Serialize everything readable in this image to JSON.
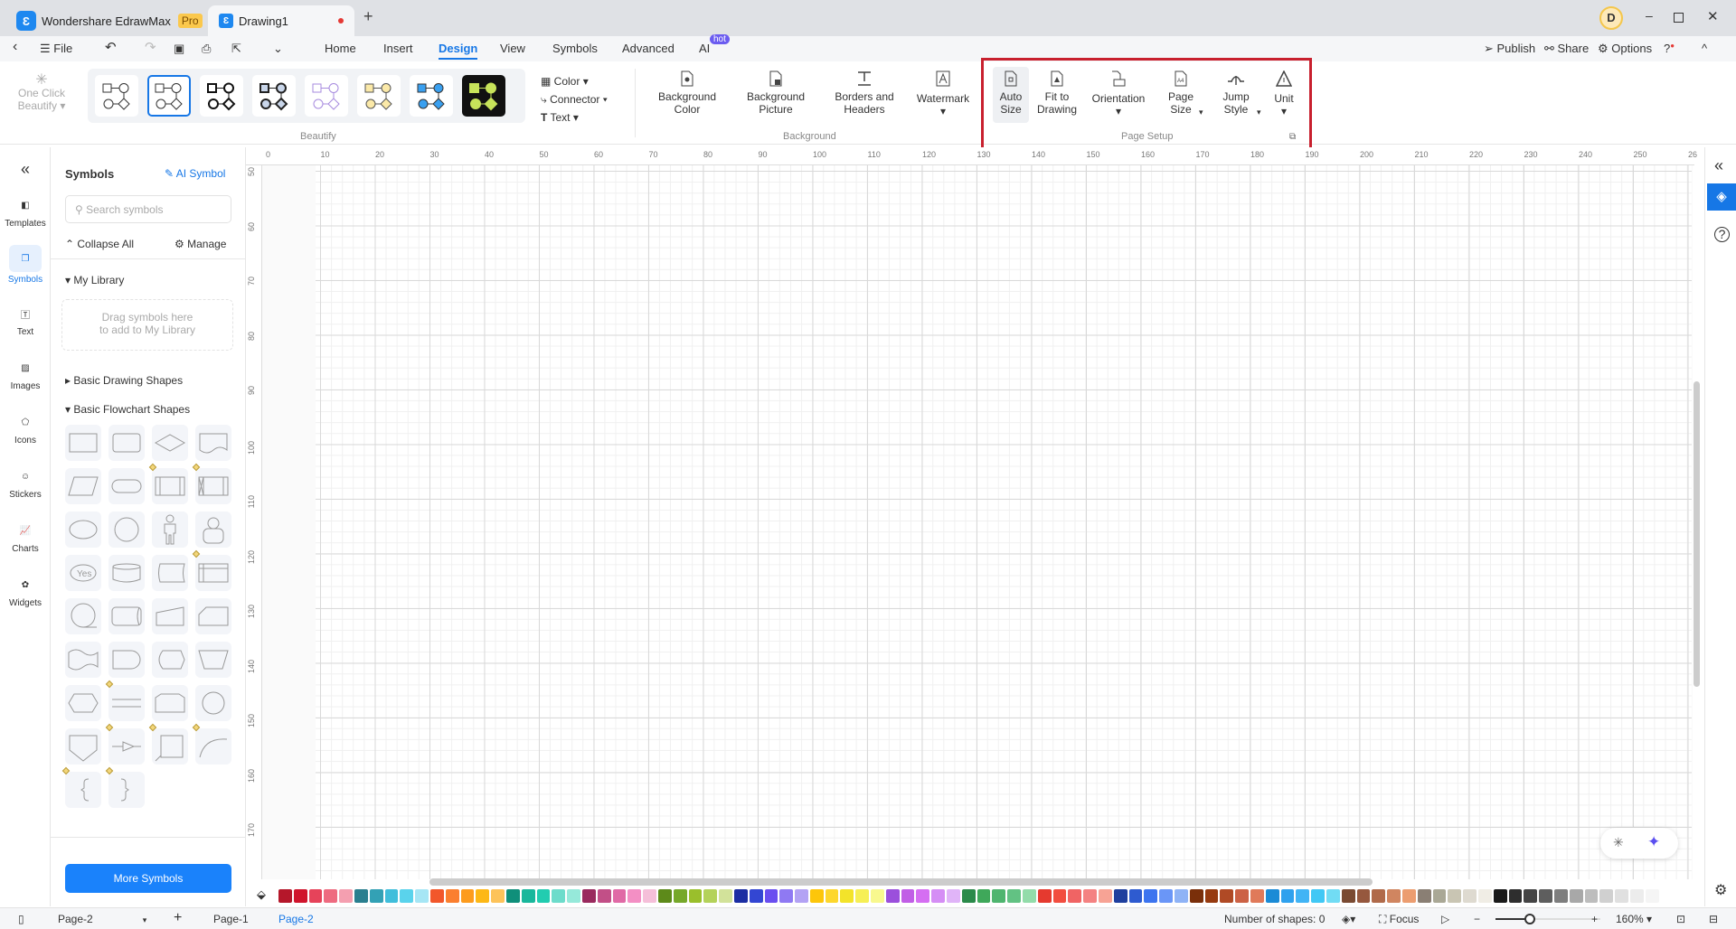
{
  "titlebar": {
    "app_name": "Wondershare EdrawMax",
    "badge": "Pro",
    "doc_tab": "Drawing1",
    "new_tab": "+",
    "avatar": "D"
  },
  "menubar": {
    "file": "File",
    "tabs": [
      "Home",
      "Insert",
      "Design",
      "View",
      "Symbols",
      "Advanced",
      "AI"
    ],
    "active_tab": "Design",
    "ai_badge": "hot",
    "publish": "Publish",
    "share": "Share",
    "options": "Options"
  },
  "ribbon": {
    "beautify": {
      "one_click": "One Click",
      "beautify_word": "Beautify",
      "group_label": "Beautify",
      "selected_index": 1
    },
    "format": {
      "color": "Color",
      "connector": "Connector",
      "text": "Text"
    },
    "background": {
      "group_label": "Background",
      "items": [
        {
          "l1": "Background",
          "l2": "Color"
        },
        {
          "l1": "Background",
          "l2": "Picture"
        },
        {
          "l1": "Borders and",
          "l2": "Headers"
        },
        {
          "l1": "Watermark",
          "l2": ""
        }
      ]
    },
    "page_setup": {
      "group_label": "Page Setup",
      "items": [
        {
          "l1": "Auto",
          "l2": "Size"
        },
        {
          "l1": "Fit to",
          "l2": "Drawing"
        },
        {
          "l1": "Orientation",
          "l2": ""
        },
        {
          "l1": "Page",
          "l2": "Size"
        },
        {
          "l1": "Jump",
          "l2": "Style"
        },
        {
          "l1": "Unit",
          "l2": ""
        }
      ],
      "highlight_color": "#c8202e"
    }
  },
  "leftnav": [
    "Templates",
    "Symbols",
    "Text",
    "Images",
    "Icons",
    "Stickers",
    "Charts",
    "Widgets"
  ],
  "panel": {
    "title": "Symbols",
    "ai_symbol": "AI Symbol",
    "search_placeholder": "Search symbols",
    "collapse_all": "Collapse All",
    "manage": "Manage",
    "my_library": "My Library",
    "drop_hint_1": "Drag symbols here",
    "drop_hint_2": "to add to My Library",
    "basic_drawing": "Basic Drawing Shapes",
    "basic_flowchart": "Basic Flowchart Shapes",
    "shape_text_yes": "Yes",
    "more_symbols": "More Symbols"
  },
  "ruler": {
    "top": [
      "0",
      "10",
      "20",
      "30",
      "40",
      "50",
      "60",
      "70",
      "80",
      "90",
      "100",
      "110",
      "120",
      "130",
      "140",
      "150",
      "160",
      "170",
      "180",
      "190",
      "200",
      "210",
      "220",
      "230",
      "240",
      "250",
      "26"
    ],
    "left": [
      "50",
      "60",
      "70",
      "80",
      "90",
      "100",
      "110",
      "120",
      "130",
      "140",
      "150",
      "160",
      "170"
    ]
  },
  "palette": [
    "#b5172a",
    "#d0142c",
    "#e6435a",
    "#ee6b80",
    "#f49fb0",
    "#2a7f8f",
    "#33a1b5",
    "#40bedb",
    "#5ad3ec",
    "#a6e6f5",
    "#f2572b",
    "#fb7f2f",
    "#fd9c1e",
    "#fdb816",
    "#fdc35a",
    "#0f8f7a",
    "#19b79c",
    "#22ccb0",
    "#6ddccb",
    "#96e9da",
    "#9a2a5e",
    "#c24f87",
    "#e06aa6",
    "#f38fc4",
    "#f5bfd9",
    "#5d8a1a",
    "#76a82a",
    "#9abf2c",
    "#b4d25a",
    "#d2e29a",
    "#1c2ea3",
    "#3346d3",
    "#6a4ef0",
    "#8f79f3",
    "#b3a2f4",
    "#fdc60a",
    "#fdd72c",
    "#f3e32a",
    "#f6ef55",
    "#f8f88e",
    "#9b4fdc",
    "#c15ee6",
    "#d56ef2",
    "#d58ef5",
    "#e0b4f8",
    "#2b8a4a",
    "#3fa85a",
    "#4fb56f",
    "#62c283",
    "#93dcaa",
    "#e53a2f",
    "#f24d3f",
    "#f06464",
    "#f48282",
    "#f7a395",
    "#1f3f9e",
    "#2e5bd0",
    "#3c74ef",
    "#6a96f7",
    "#8fb3f6",
    "#7a2f0a",
    "#963a0f",
    "#b04a25",
    "#cc6245",
    "#e07a5a",
    "#1b8bd6",
    "#2fa1ee",
    "#41b4f5",
    "#41c8f5",
    "#71dcf4",
    "#7a4a32",
    "#96583e",
    "#b06a4a",
    "#d08560",
    "#ec9d70",
    "#8a7f74",
    "#aaa896",
    "#c9c5b3",
    "#dedad0",
    "#f0ede5",
    "#1a1a1a",
    "#2e2e2e",
    "#444444",
    "#5e5e5e",
    "#7e7e7e",
    "#a8a8a8",
    "#bdbdbd",
    "#d0d0d0",
    "#e0e0e0",
    "#ececec",
    "#f5f5f5"
  ],
  "status": {
    "page_select": "Page-2",
    "add_page": "+",
    "pages": [
      "Page-1",
      "Page-2"
    ],
    "active_page": "Page-2",
    "shapes_count": "Number of shapes: 0",
    "focus": "Focus",
    "zoom": "160%",
    "zoom_minus": "−",
    "zoom_plus": "+",
    "zoom_level": 0.33
  },
  "colors": {
    "accent": "#1677e6",
    "button": "#1a82fb"
  }
}
